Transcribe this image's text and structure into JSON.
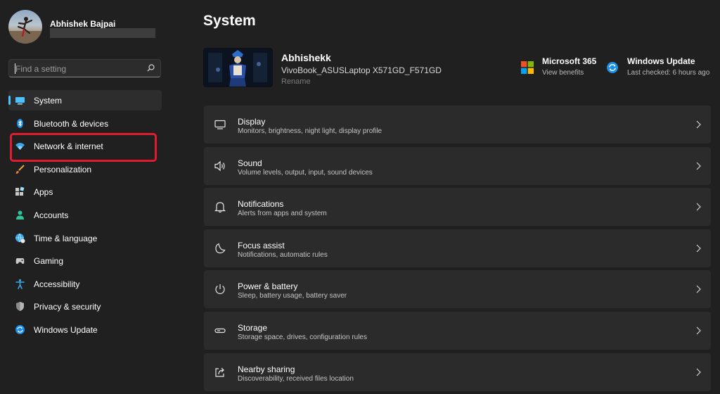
{
  "user": {
    "name": "Abhishek Bajpai"
  },
  "search": {
    "placeholder": "Find a setting"
  },
  "sidebar": {
    "items": [
      {
        "label": "System",
        "icon": "system-icon",
        "selected": true
      },
      {
        "label": "Bluetooth & devices",
        "icon": "bluetooth-icon"
      },
      {
        "label": "Network & internet",
        "icon": "wifi-icon"
      },
      {
        "label": "Personalization",
        "icon": "brush-icon"
      },
      {
        "label": "Apps",
        "icon": "apps-icon"
      },
      {
        "label": "Accounts",
        "icon": "person-icon"
      },
      {
        "label": "Time & language",
        "icon": "globe-clock-icon"
      },
      {
        "label": "Gaming",
        "icon": "gamepad-icon"
      },
      {
        "label": "Accessibility",
        "icon": "accessibility-icon"
      },
      {
        "label": "Privacy & security",
        "icon": "shield-icon"
      },
      {
        "label": "Windows Update",
        "icon": "update-icon"
      }
    ]
  },
  "main": {
    "title": "System",
    "device": {
      "name": "Abhishekk",
      "model": "VivoBook_ASUSLaptop X571GD_F571GD",
      "rename": "Rename"
    },
    "quick_links": [
      {
        "title": "Microsoft 365",
        "subtitle": "View benefits",
        "icon": "microsoft-logo-icon"
      },
      {
        "title": "Windows Update",
        "subtitle": "Last checked: 6 hours ago",
        "icon": "update-icon"
      }
    ],
    "cards": [
      {
        "title": "Display",
        "subtitle": "Monitors, brightness, night light, display profile",
        "icon": "monitor-icon"
      },
      {
        "title": "Sound",
        "subtitle": "Volume levels, output, input, sound devices",
        "icon": "speaker-icon"
      },
      {
        "title": "Notifications",
        "subtitle": "Alerts from apps and system",
        "icon": "bell-icon"
      },
      {
        "title": "Focus assist",
        "subtitle": "Notifications, automatic rules",
        "icon": "moon-icon"
      },
      {
        "title": "Power & battery",
        "subtitle": "Sleep, battery usage, battery saver",
        "icon": "power-icon"
      },
      {
        "title": "Storage",
        "subtitle": "Storage space, drives, configuration rules",
        "icon": "storage-icon"
      },
      {
        "title": "Nearby sharing",
        "subtitle": "Discoverability, received files location",
        "icon": "share-icon"
      }
    ]
  },
  "colors": {
    "accent": "#4cc2ff",
    "highlight": "#e31b2f",
    "background": "#202020",
    "card": "#2b2b2b"
  }
}
